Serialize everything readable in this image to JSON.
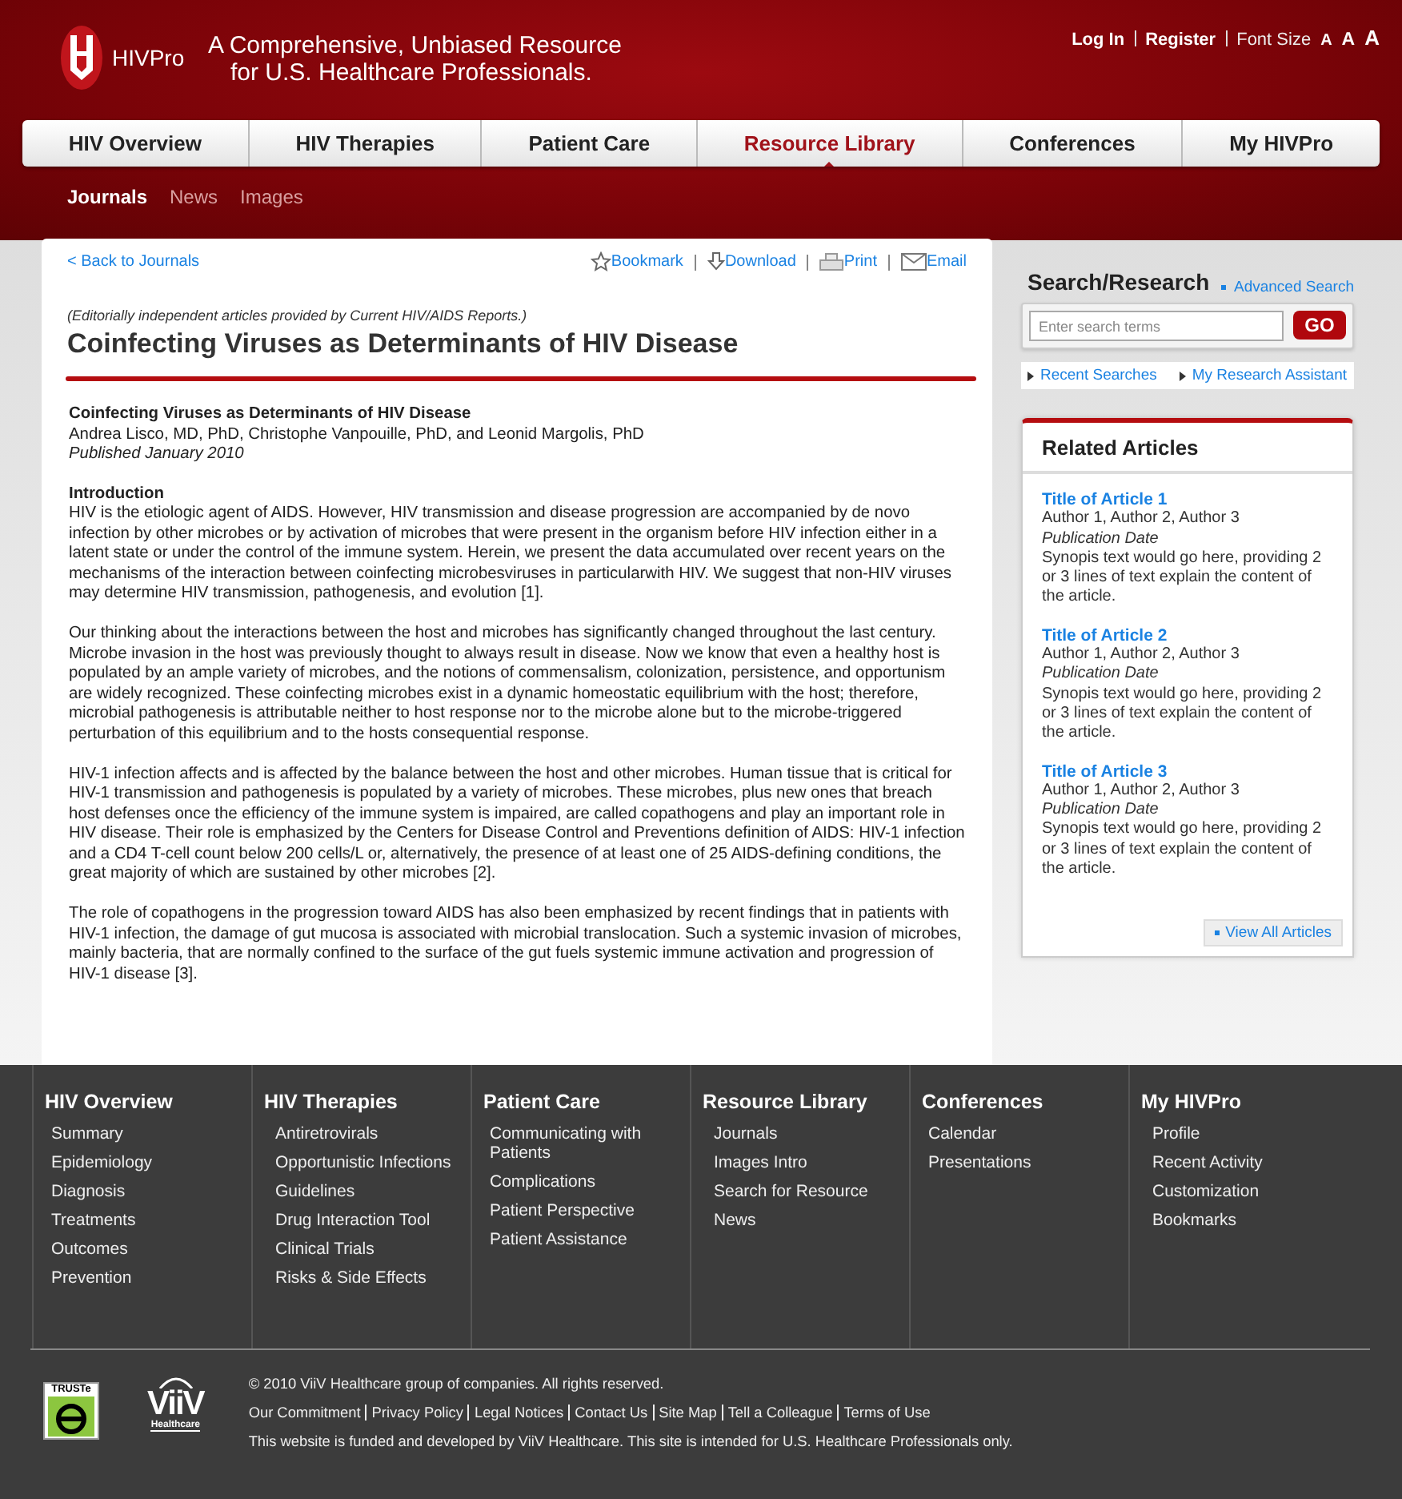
{
  "header": {
    "logo": "HIVPro",
    "tagline": [
      "A Comprehensive, Unbiased Resource",
      "for U.S. Healthcare Professionals."
    ],
    "links": [
      "Log In",
      "Register"
    ],
    "font_size": {
      "label": "Font Size",
      "sizes": [
        "A",
        "A",
        "A"
      ]
    }
  },
  "nav": [
    {
      "label": "HIV Overview",
      "selected": false
    },
    {
      "label": "HIV Therapies",
      "selected": false
    },
    {
      "label": "Patient Care",
      "selected": false
    },
    {
      "label": "Resource Library",
      "selected": true
    },
    {
      "label": "Conferences",
      "selected": false
    },
    {
      "label": "My HIVPro",
      "selected": false
    }
  ],
  "subnav": [
    {
      "label": "Journals",
      "selected": true
    },
    {
      "label": "News",
      "selected": false
    },
    {
      "label": "Images",
      "selected": false
    }
  ],
  "article": {
    "back": "< Back to Journals",
    "actions": [
      {
        "kind": "star",
        "label": "Bookmark"
      },
      {
        "kind": "download",
        "label": "Download"
      },
      {
        "kind": "print",
        "label": "Print"
      },
      {
        "kind": "email",
        "label": "Email"
      }
    ],
    "source": "(Editorially independent articles provided by Current HIV/AIDS Reports.)",
    "title": "Coinfecting Viruses as Determinants of HIV Disease",
    "subtitle": "Coinfecting Viruses as Determinants of HIV Disease",
    "authors": "Andrea Lisco, MD, PhD, Christophe Vanpouille, PhD, and Leonid Margolis, PhD",
    "published": "Published January 2010",
    "section": "Introduction",
    "paragraphs": [
      "HIV is the etiologic agent of AIDS. However, HIV transmission and disease progression are accompanied by de novo infection by other microbes or by activation of microbes that were present in the organism before HIV infection either in a latent state or under the control of the immune system. Herein, we present the data accumulated over recent years on the mechanisms of the interaction between coinfecting microbesviruses in particularwith HIV. We suggest that non-HIV viruses may determine HIV transmission, pathogenesis, and evolution [1].",
      "Our thinking about the interactions between the host and microbes has significantly changed throughout the last century. Microbe invasion in the host was previously thought to always result in disease. Now we know that even a healthy host is populated by an ample variety of microbes, and the notions of commensalism, colonization, persistence, and opportunism are widely recognized. These coinfecting microbes exist in a dynamic homeostatic equilibrium with the host; therefore, microbial pathogenesis is attributable neither to host response nor to the microbe alone but to the microbe-triggered perturbation of this equilibrium and to the hosts consequential response.",
      "HIV-1 infection affects and is affected by the balance between the host and other microbes. Human tissue that is critical for HIV-1 transmission and pathogenesis is populated by a variety of microbes. These microbes, plus new ones that breach host defenses once the efficiency of the immune system is impaired, are called copathogens and play an important role in HIV disease. Their role is emphasized by the Centers for Disease Control and Preventions definition of AIDS: HIV-1 infection and a CD4 T-cell count below 200 cells/L or, alternatively, the presence of at least one of 25 AIDS-defining conditions, the great majority of which are sustained by other microbes [2].",
      "The role of copathogens in the progression toward AIDS has also been emphasized by recent findings that in patients with HIV-1 infection, the damage of gut mucosa is associated with microbial translocation. Such a systemic invasion of microbes, mainly bacteria, that are normally confined to the surface of the gut fuels systemic immune activation and progression of HIV-1 disease [3]."
    ]
  },
  "search": {
    "title": "Search/Research",
    "advanced": "Advanced Search",
    "placeholder": "Enter search terms",
    "button": "GO",
    "links": [
      "Recent Searches",
      "My Research Assistant"
    ]
  },
  "related": {
    "title": "Related Articles",
    "articles": [
      {
        "title": "Title of Article 1",
        "authors": "Author 1, Author 2, Author 3",
        "date": "Publication Date",
        "synopsis": "Synopis text would go here, providing 2 or 3 lines of text explain the content of the article."
      },
      {
        "title": "Title of Article 2",
        "authors": "Author 1, Author 2, Author 3",
        "date": "Publication Date",
        "synopsis": "Synopis text would go here, providing 2 or 3 lines of text explain the content of the article."
      },
      {
        "title": "Title of Article 3",
        "authors": "Author 1, Author 2, Author 3",
        "date": "Publication Date",
        "synopsis": "Synopis text would go here, providing 2 or 3 lines of text explain the content of the article."
      }
    ],
    "view_all": "View All Articles"
  },
  "footer": {
    "columns": [
      {
        "title": "HIV Overview",
        "items": [
          "Summary",
          "Epidemiology",
          "Diagnosis",
          "Treatments",
          "Outcomes",
          "Prevention"
        ]
      },
      {
        "title": "HIV Therapies",
        "items": [
          "Antiretrovirals",
          "Opportunistic Infections",
          "Guidelines",
          "Drug Interaction Tool",
          "Clinical Trials",
          "Risks & Side Effects"
        ]
      },
      {
        "title": "Patient Care",
        "items": [
          "Communicating with Patients",
          "Complications",
          "Patient Perspective",
          "Patient Assistance"
        ]
      },
      {
        "title": "Resource Library",
        "items": [
          "Journals",
          "Images Intro",
          "Search for Resource",
          "News"
        ]
      },
      {
        "title": "Conferences",
        "items": [
          "Calendar",
          "Presentations"
        ]
      },
      {
        "title": "My HIVPro",
        "items": [
          "Profile",
          "Recent Activity",
          "Customization",
          "Bookmarks"
        ]
      }
    ],
    "truste": "TRUSTe",
    "viiv": {
      "name": "ViiV",
      "sub": "Healthcare"
    },
    "copyright": "© 2010 ViiV Healthcare group of companies. All rights reserved.",
    "links": [
      "Our Commitment",
      "Privacy Policy",
      "Legal Notices",
      "Contact Us",
      "Site Map",
      "Tell a Colleague",
      "Terms of Use"
    ],
    "notice": "This website is funded and developed by ViiV Healthcare. This site is intended for U.S. Healthcare Professionals only."
  }
}
